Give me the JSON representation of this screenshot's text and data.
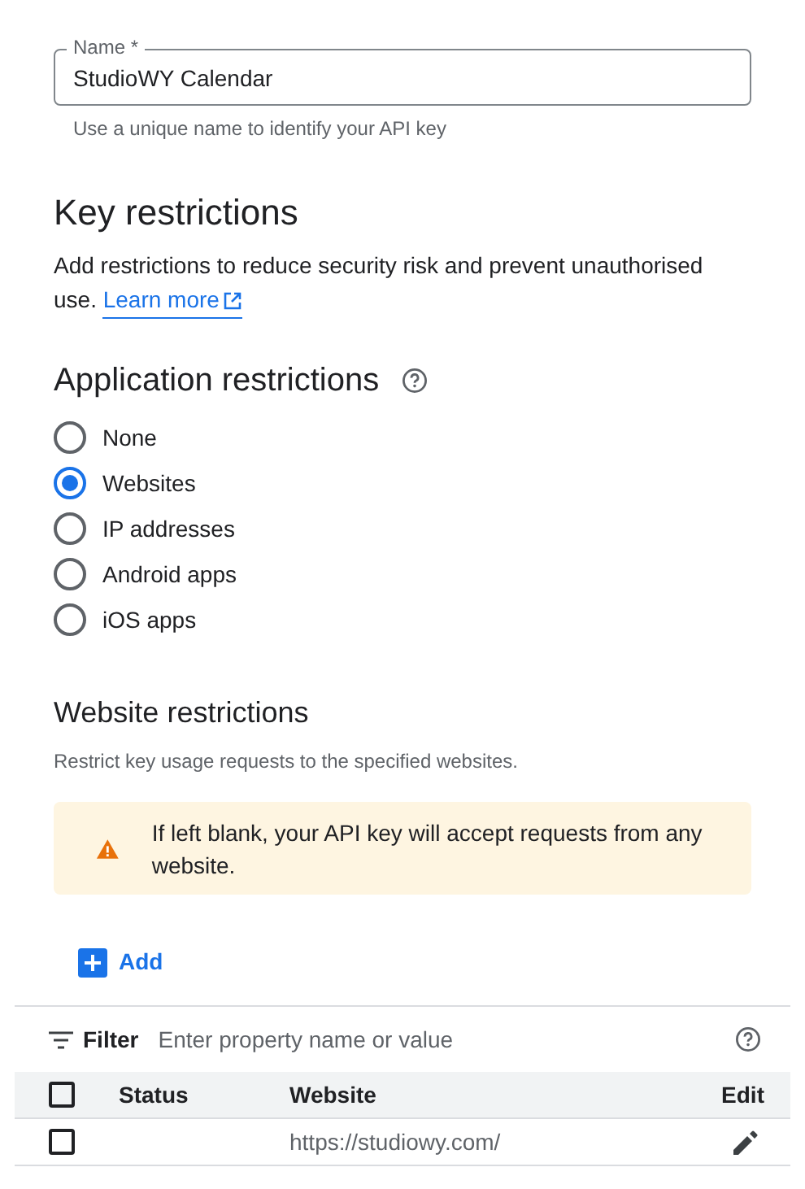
{
  "name_field": {
    "label": "Name *",
    "value": "StudioWY Calendar",
    "hint": "Use a unique name to identify your API key"
  },
  "key_restrictions": {
    "title": "Key restrictions",
    "description": "Add restrictions to reduce security risk and prevent unauthorised use.",
    "link": "Learn more"
  },
  "application_restrictions": {
    "title": "Application restrictions",
    "options": [
      {
        "label": "None",
        "selected": false
      },
      {
        "label": "Websites",
        "selected": true
      },
      {
        "label": "IP addresses",
        "selected": false
      },
      {
        "label": "Android apps",
        "selected": false
      },
      {
        "label": "iOS apps",
        "selected": false
      }
    ]
  },
  "website_restrictions": {
    "title": "Website restrictions",
    "description": "Restrict key usage requests to the specified websites.",
    "warning": "If left blank, your API key will accept requests from any website.",
    "add_button": "Add"
  },
  "table": {
    "filter_label": "Filter",
    "filter_placeholder": "Enter property name or value",
    "header_checked": false,
    "columns": [
      "Status",
      "Website",
      "Edit"
    ],
    "rows": [
      {
        "checked": false,
        "status": "",
        "website": "https://studiowy.com/"
      }
    ]
  }
}
